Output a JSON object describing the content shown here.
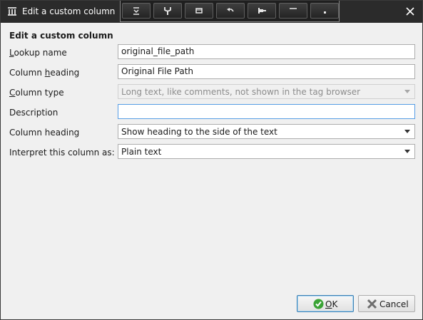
{
  "window": {
    "title": "Edit a custom column",
    "toolbar_icons": [
      "drop-down-icon",
      "wrench-icon",
      "window-icon",
      "undo-icon",
      "pin-icon",
      "minimize-icon",
      "dot-icon"
    ],
    "close_icon": "close-icon"
  },
  "form": {
    "heading": "Edit a custom column",
    "rows": {
      "lookup": {
        "label_prefix": "",
        "label_mnemonic": "L",
        "label_rest": "ookup name",
        "value": "original_file_path"
      },
      "column_heading": {
        "label_prefix": "Column ",
        "label_mnemonic": "h",
        "label_rest": "eading",
        "value": "Original File Path"
      },
      "column_type": {
        "label_prefix": "",
        "label_mnemonic": "C",
        "label_rest": "olumn type",
        "value": "Long text, like comments, not shown in the tag browser",
        "disabled": true
      },
      "description": {
        "label": "Description",
        "value": ""
      },
      "heading_position": {
        "label": "Column heading",
        "value": "Show heading to the side of the text"
      },
      "interpret": {
        "label": "Interpret this column as:",
        "value": "Plain text"
      }
    }
  },
  "buttons": {
    "ok": {
      "mnemonic": "O",
      "rest": "K",
      "icon": "check-icon"
    },
    "cancel": {
      "label": "Cancel",
      "icon": "x-icon"
    }
  },
  "colors": {
    "titlebar": "#2b2b2b",
    "focus_border": "#569de5",
    "ok_icon": "#3aa335",
    "cancel_icon": "#6e6e6e"
  }
}
